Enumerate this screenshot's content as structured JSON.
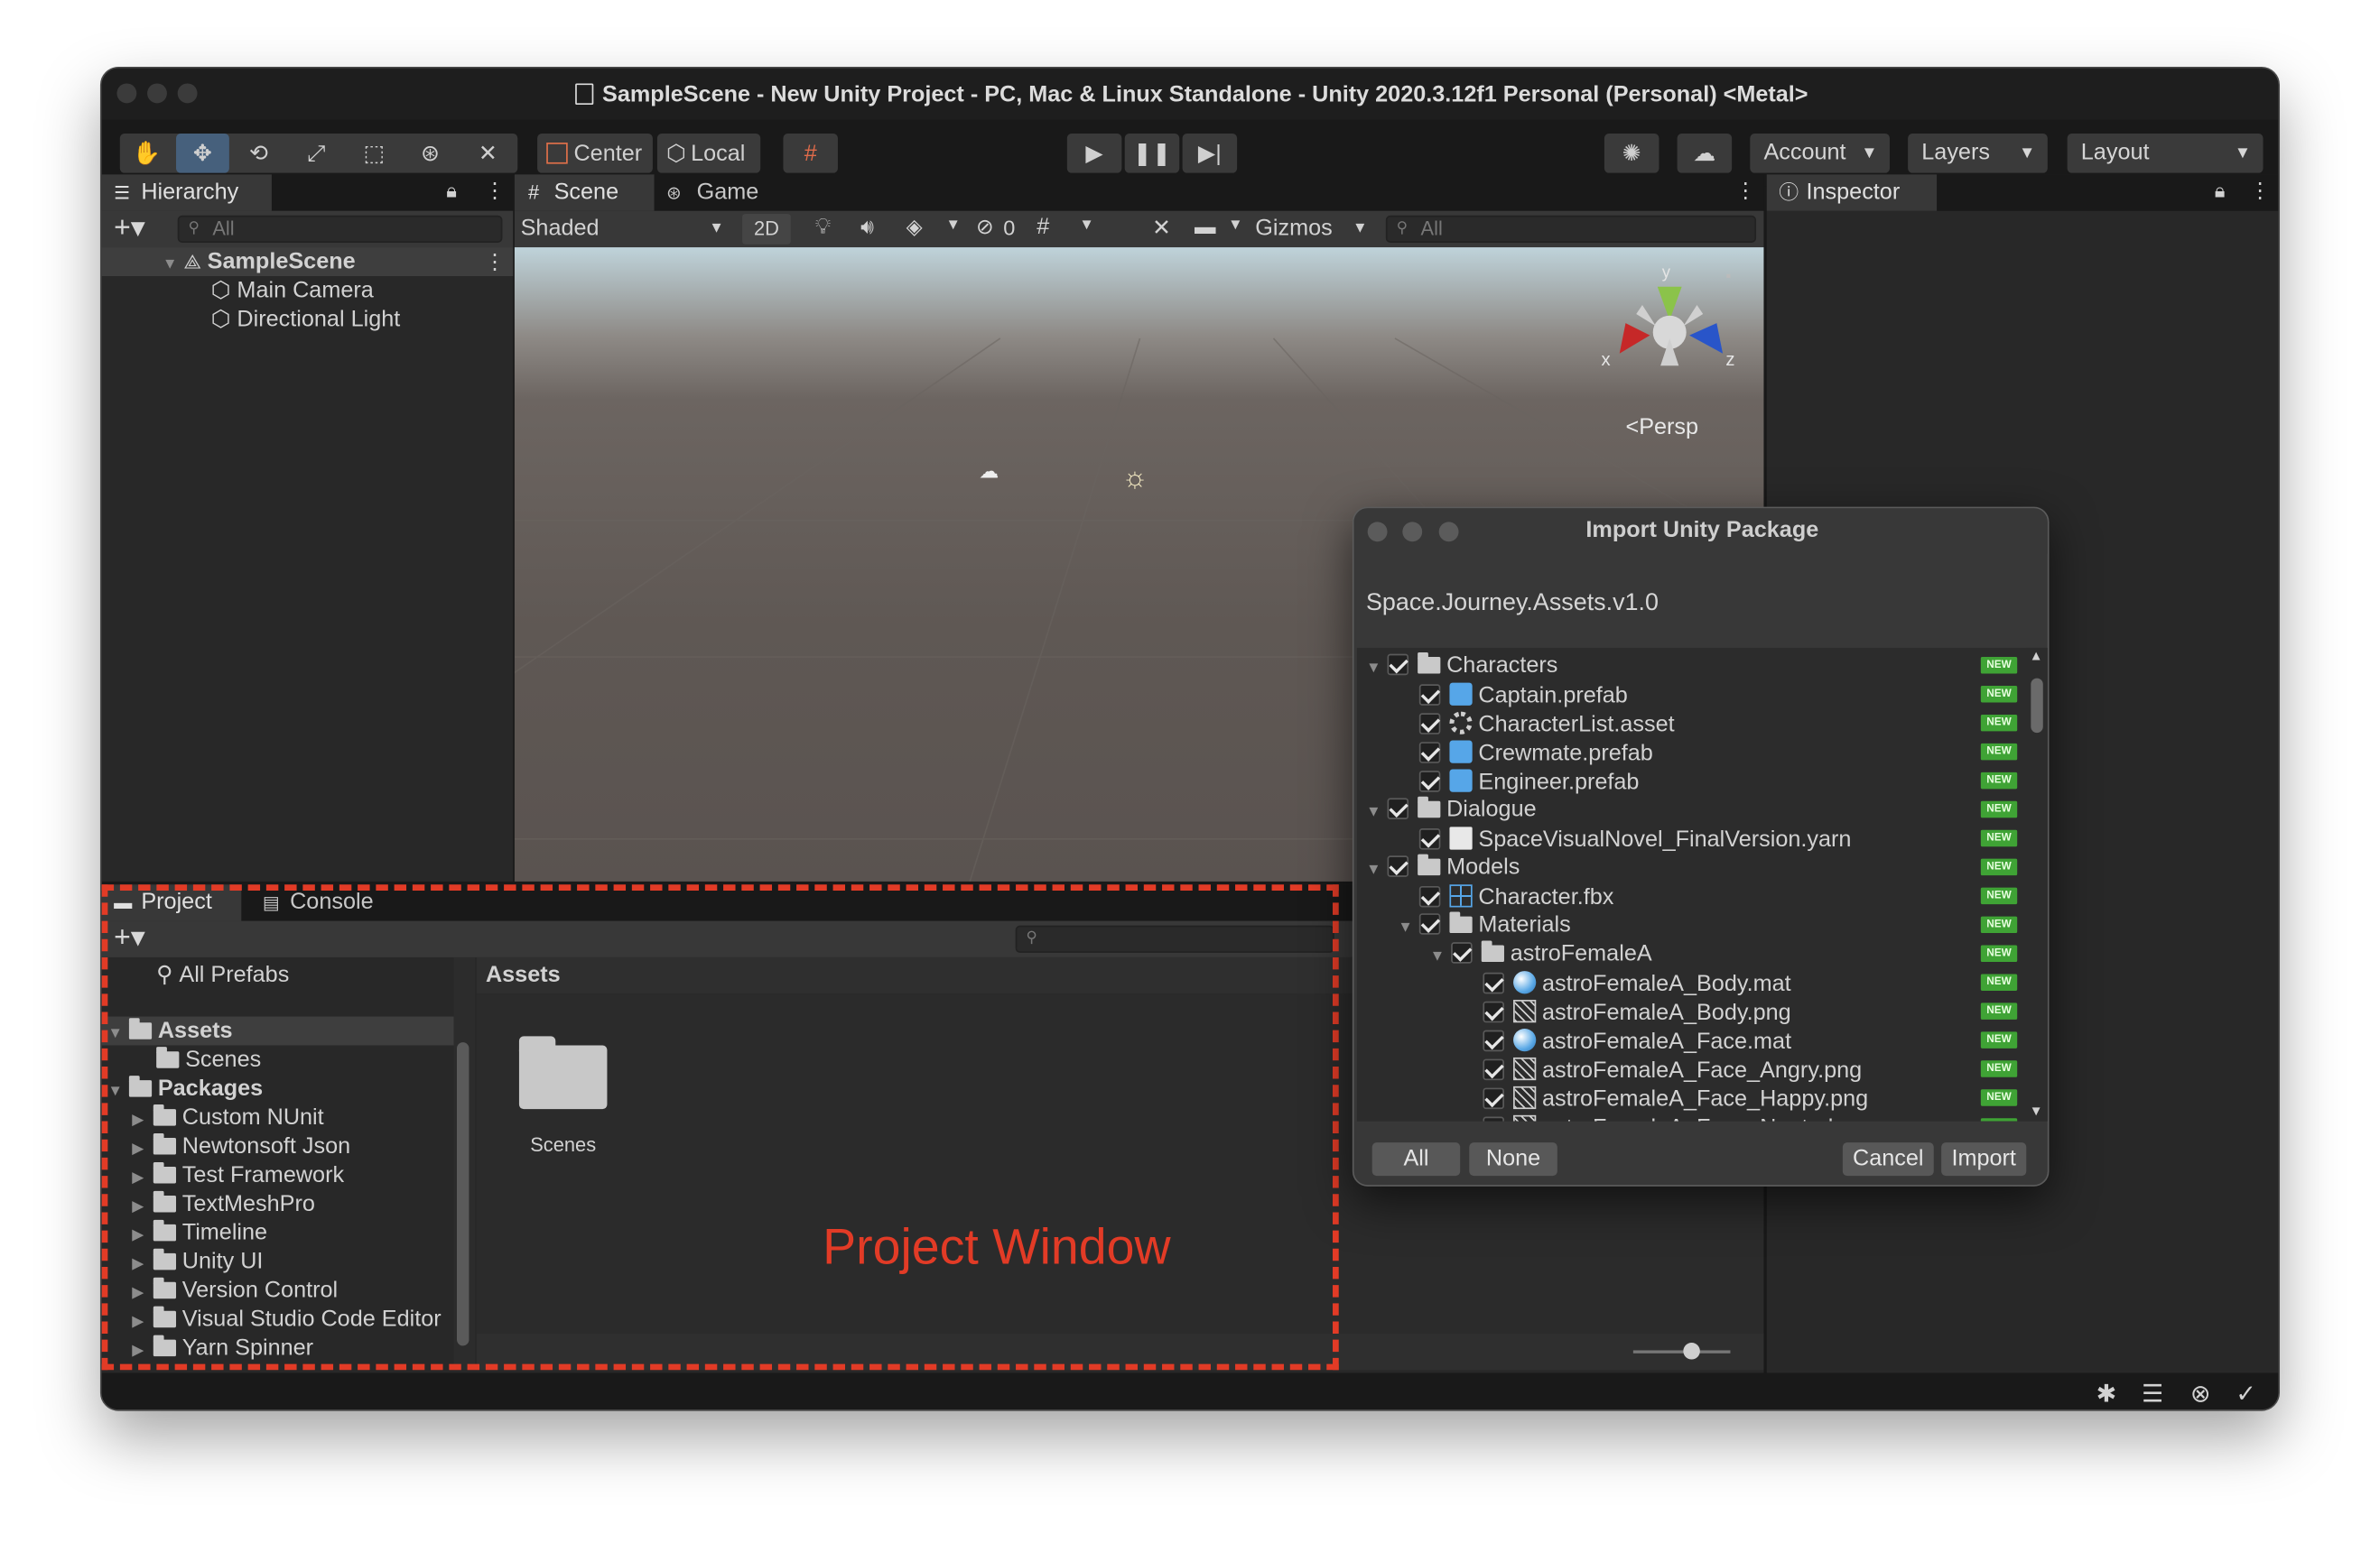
{
  "window": {
    "title": "SampleScene - New Unity Project - PC, Mac & Linux Standalone - Unity 2020.3.12f1 Personal (Personal) <Metal>"
  },
  "toolbar": {
    "pivot": "Center",
    "space": "Local",
    "account": "Account",
    "layers": "Layers",
    "layout": "Layout"
  },
  "hierarchy": {
    "tab": "Hierarchy",
    "search_placeholder": "All",
    "scene": "SampleScene",
    "objects": [
      "Main Camera",
      "Directional Light"
    ]
  },
  "scene_view": {
    "tabs": [
      "Scene",
      "Game"
    ],
    "shading": "Shaded",
    "mode_2d": "2D",
    "hidden_count": "0",
    "gizmos": "Gizmos",
    "search_placeholder": "All",
    "persp": "Persp",
    "axes": {
      "x": "x",
      "y": "y",
      "z": "z"
    }
  },
  "inspector": {
    "tab": "Inspector"
  },
  "project": {
    "tabs": [
      "Project",
      "Console"
    ],
    "favorites": "All Prefabs",
    "assets_root": "Assets",
    "assets_children": [
      "Scenes"
    ],
    "packages_root": "Packages",
    "packages": [
      "Custom NUnit",
      "Newtonsoft Json",
      "Test Framework",
      "TextMeshPro",
      "Timeline",
      "Unity UI",
      "Version Control",
      "Visual Studio Code Editor",
      "Yarn Spinner"
    ],
    "breadcrumb": "Assets",
    "folder_items": [
      "Scenes"
    ],
    "zoom_level": 0.6
  },
  "annotation": {
    "label": "Project Window",
    "color": "#e23b26"
  },
  "import_dialog": {
    "title": "Import Unity Package",
    "package_name": "Space.Journey.Assets.v1.0",
    "new_badge": "NEW",
    "items": [
      {
        "name": "Characters",
        "kind": "folder"
      },
      {
        "name": "Captain.prefab",
        "kind": "prefab"
      },
      {
        "name": "CharacterList.asset",
        "kind": "asset"
      },
      {
        "name": "Crewmate.prefab",
        "kind": "prefab"
      },
      {
        "name": "Engineer.prefab",
        "kind": "prefab"
      },
      {
        "name": "Dialogue",
        "kind": "folder"
      },
      {
        "name": "SpaceVisualNovel_FinalVersion.yarn",
        "kind": "doc"
      },
      {
        "name": "Models",
        "kind": "folder"
      },
      {
        "name": "Character.fbx",
        "kind": "model"
      },
      {
        "name": "Materials",
        "kind": "folder"
      },
      {
        "name": "astroFemaleA",
        "kind": "folder"
      },
      {
        "name": "astroFemaleA_Body.mat",
        "kind": "material"
      },
      {
        "name": "astroFemaleA_Body.png",
        "kind": "texture"
      },
      {
        "name": "astroFemaleA_Face.mat",
        "kind": "material"
      },
      {
        "name": "astroFemaleA_Face_Angry.png",
        "kind": "texture"
      },
      {
        "name": "astroFemaleA_Face_Happy.png",
        "kind": "texture"
      },
      {
        "name": "astroFemaleA_Face_Neutral.png",
        "kind": "texture"
      }
    ],
    "buttons": {
      "all": "All",
      "none": "None",
      "cancel": "Cancel",
      "import": "Import"
    }
  }
}
